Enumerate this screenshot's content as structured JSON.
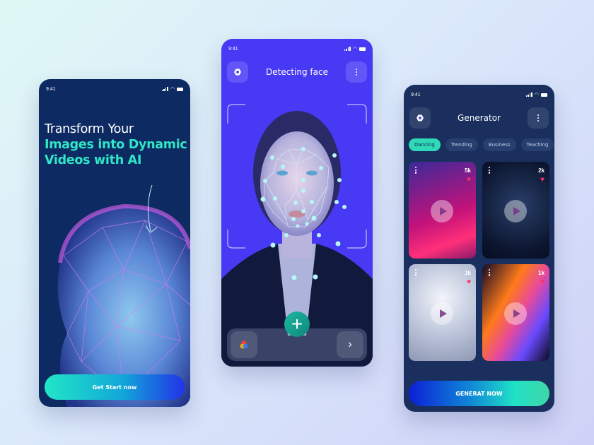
{
  "colors": {
    "accent_teal": "#2fe6c6",
    "brand_blue": "#4839f5",
    "navy": "#0e2a63",
    "heart": "#ff2f6a"
  },
  "status_bar": {
    "time": "9:41"
  },
  "onboarding": {
    "headline_line1": "Transform Your",
    "headline_line2": "Images into Dynamic",
    "headline_line3": "Videos with AI",
    "cta_label": "Get Start now"
  },
  "detect": {
    "title": "Detecting face",
    "left_icon": "settings-hex-icon",
    "right_icon": "more-vertical-icon",
    "plus_icon": "plus-icon",
    "gallery_icon": "color-palette-icon",
    "next_icon": "chevron-right-icon",
    "plus_label": "+",
    "next_label": "›"
  },
  "generator": {
    "title": "Generator",
    "chips": [
      {
        "label": "Dancing",
        "active": true
      },
      {
        "label": "Trending",
        "active": false
      },
      {
        "label": "Business",
        "active": false
      },
      {
        "label": "Teaching",
        "active": false
      }
    ],
    "videos": [
      {
        "likes": "5k"
      },
      {
        "likes": "2k"
      },
      {
        "likes": "1k"
      },
      {
        "likes": "1k"
      }
    ],
    "cta_label": "GENERAT NOW"
  }
}
